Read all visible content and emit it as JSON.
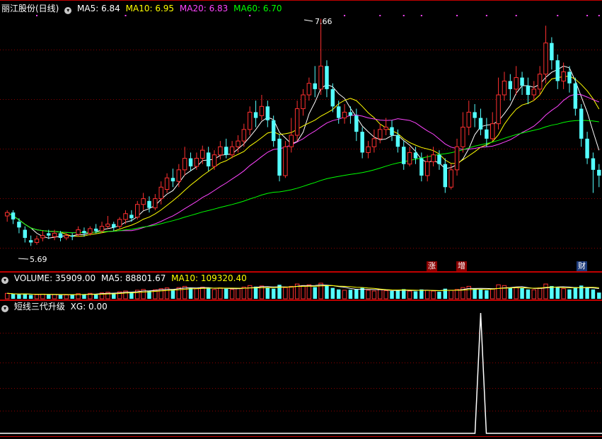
{
  "title": "丽江股份(日线)",
  "ma_legend": [
    {
      "label": "MA5: 6.84",
      "color": "#ffffff"
    },
    {
      "label": "MA10: 6.95",
      "color": "#ffff00"
    },
    {
      "label": "MA20: 6.83",
      "color": "#ff44ff"
    },
    {
      "label": "MA60: 6.70",
      "color": "#00ff00"
    }
  ],
  "high_label": "7.66",
  "low_label": "5.69",
  "volume_header": {
    "name": "VOLUME: 35909.00",
    "ma5": "MA5: 88801.67",
    "ma10": "MA10: 109320.40"
  },
  "indicator_header": {
    "name": "短线三代升级",
    "xg": "XG: 0.00"
  },
  "event_tags": [
    "涨",
    "增",
    "财"
  ],
  "colors": {
    "up": "#ff3030",
    "down": "#54ffff",
    "grid": "#8b0000",
    "ma5": "#ffffff",
    "ma10": "#ffff00",
    "ma20": "#ff44ff",
    "ma60": "#00ff00"
  },
  "chart_data": {
    "type": "candlestick",
    "ylim": [
      5.6,
      7.7
    ],
    "candles": [
      [
        5.95,
        5.98,
        5.9,
        6.0
      ],
      [
        5.98,
        5.92,
        5.88,
        6.0
      ],
      [
        5.9,
        5.85,
        5.8,
        5.93
      ],
      [
        5.83,
        5.76,
        5.72,
        5.86
      ],
      [
        5.74,
        5.72,
        5.69,
        5.78
      ],
      [
        5.72,
        5.75,
        5.7,
        5.78
      ],
      [
        5.76,
        5.78,
        5.73,
        5.82
      ],
      [
        5.8,
        5.78,
        5.75,
        5.83
      ],
      [
        5.77,
        5.8,
        5.74,
        5.83
      ],
      [
        5.8,
        5.76,
        5.73,
        5.82
      ],
      [
        5.76,
        5.78,
        5.74,
        5.8
      ],
      [
        5.78,
        5.77,
        5.74,
        5.8
      ],
      [
        5.79,
        5.83,
        5.77,
        5.86
      ],
      [
        5.82,
        5.8,
        5.77,
        5.85
      ],
      [
        5.8,
        5.84,
        5.78,
        5.86
      ],
      [
        5.84,
        5.82,
        5.8,
        5.88
      ],
      [
        5.82,
        5.86,
        5.8,
        5.9
      ],
      [
        5.86,
        5.88,
        5.84,
        5.95
      ],
      [
        5.88,
        5.85,
        5.82,
        5.9
      ],
      [
        5.86,
        5.92,
        5.84,
        5.94
      ],
      [
        5.92,
        5.97,
        5.88,
        6.0
      ],
      [
        5.96,
        5.93,
        5.9,
        6.0
      ],
      [
        5.94,
        6.05,
        5.92,
        6.08
      ],
      [
        6.05,
        6.1,
        6.0,
        6.15
      ],
      [
        6.08,
        6.02,
        5.98,
        6.12
      ],
      [
        6.02,
        6.1,
        6.0,
        6.14
      ],
      [
        6.1,
        6.2,
        6.05,
        6.25
      ],
      [
        6.18,
        6.28,
        6.15,
        6.32
      ],
      [
        6.28,
        6.25,
        6.2,
        6.36
      ],
      [
        6.25,
        6.35,
        6.2,
        6.4
      ],
      [
        6.35,
        6.45,
        6.3,
        6.55
      ],
      [
        6.45,
        6.38,
        6.34,
        6.5
      ],
      [
        6.38,
        6.45,
        6.35,
        6.5
      ],
      [
        6.45,
        6.52,
        6.4,
        6.56
      ],
      [
        6.5,
        6.38,
        6.34,
        6.55
      ],
      [
        6.38,
        6.48,
        6.35,
        6.52
      ],
      [
        6.48,
        6.55,
        6.44,
        6.6
      ],
      [
        6.55,
        6.48,
        6.45,
        6.62
      ],
      [
        6.48,
        6.55,
        6.45,
        6.6
      ],
      [
        6.55,
        6.6,
        6.5,
        6.65
      ],
      [
        6.6,
        6.7,
        6.55,
        6.75
      ],
      [
        6.7,
        6.85,
        6.65,
        6.9
      ],
      [
        6.85,
        6.8,
        6.72,
        6.95
      ],
      [
        6.82,
        6.9,
        6.78,
        7.0
      ],
      [
        6.9,
        6.78,
        6.72,
        6.95
      ],
      [
        6.78,
        6.6,
        6.55,
        6.82
      ],
      [
        6.62,
        6.3,
        6.25,
        6.66
      ],
      [
        6.3,
        6.55,
        6.28,
        6.6
      ],
      [
        6.55,
        6.65,
        6.5,
        6.8
      ],
      [
        6.65,
        6.88,
        6.6,
        6.95
      ],
      [
        6.88,
        7.0,
        6.82,
        7.05
      ],
      [
        7.0,
        7.1,
        6.95,
        7.15
      ],
      [
        7.1,
        7.05,
        6.98,
        7.25
      ],
      [
        7.05,
        7.25,
        7.0,
        7.66
      ],
      [
        7.25,
        7.05,
        6.98,
        7.3
      ],
      [
        7.05,
        6.9,
        6.85,
        7.1
      ],
      [
        6.9,
        6.8,
        6.75,
        6.95
      ],
      [
        6.8,
        6.85,
        6.75,
        6.92
      ],
      [
        6.85,
        6.82,
        6.75,
        6.9
      ],
      [
        6.82,
        6.68,
        6.6,
        6.88
      ],
      [
        6.68,
        6.5,
        6.45,
        6.72
      ],
      [
        6.5,
        6.55,
        6.45,
        6.6
      ],
      [
        6.55,
        6.62,
        6.5,
        6.7
      ],
      [
        6.62,
        6.7,
        6.58,
        6.75
      ],
      [
        6.7,
        6.72,
        6.65,
        6.8
      ],
      [
        6.72,
        6.65,
        6.6,
        6.78
      ],
      [
        6.65,
        6.55,
        6.5,
        6.7
      ],
      [
        6.55,
        6.4,
        6.35,
        6.6
      ],
      [
        6.4,
        6.5,
        6.38,
        6.55
      ],
      [
        6.5,
        6.45,
        6.4,
        6.55
      ],
      [
        6.45,
        6.3,
        6.25,
        6.5
      ],
      [
        6.3,
        6.42,
        6.25,
        6.48
      ],
      [
        6.42,
        6.48,
        6.38,
        6.55
      ],
      [
        6.48,
        6.4,
        6.35,
        6.52
      ],
      [
        6.4,
        6.2,
        6.15,
        6.45
      ],
      [
        6.2,
        6.35,
        6.18,
        6.4
      ],
      [
        6.35,
        6.55,
        6.3,
        6.62
      ],
      [
        6.55,
        6.72,
        6.5,
        6.85
      ],
      [
        6.72,
        6.85,
        6.65,
        6.95
      ],
      [
        6.85,
        6.8,
        6.72,
        6.92
      ],
      [
        6.8,
        6.7,
        6.65,
        6.88
      ],
      [
        6.7,
        6.62,
        6.55,
        6.8
      ],
      [
        6.62,
        6.75,
        6.6,
        6.85
      ],
      [
        6.75,
        7.0,
        6.7,
        7.15
      ],
      [
        7.0,
        7.12,
        6.95,
        7.2
      ],
      [
        7.12,
        7.05,
        6.95,
        7.18
      ],
      [
        7.05,
        7.15,
        7.0,
        7.25
      ],
      [
        7.15,
        7.08,
        7.0,
        7.2
      ],
      [
        7.08,
        7.0,
        6.92,
        7.15
      ],
      [
        7.0,
        7.05,
        6.95,
        7.12
      ],
      [
        7.05,
        7.18,
        7.0,
        7.25
      ],
      [
        7.18,
        7.45,
        7.1,
        7.6
      ],
      [
        7.45,
        7.3,
        7.22,
        7.5
      ],
      [
        7.3,
        7.12,
        7.05,
        7.35
      ],
      [
        7.12,
        7.2,
        7.05,
        7.28
      ],
      [
        7.2,
        7.1,
        7.02,
        7.25
      ],
      [
        7.1,
        6.88,
        6.82,
        7.15
      ],
      [
        6.88,
        6.62,
        6.55,
        6.92
      ],
      [
        6.62,
        6.45,
        6.4,
        6.68
      ],
      [
        6.45,
        6.35,
        6.15,
        6.5
      ],
      [
        6.35,
        6.3,
        6.2,
        6.4
      ]
    ],
    "volume": [
      0.35,
      0.3,
      0.28,
      0.32,
      0.25,
      0.27,
      0.3,
      0.26,
      0.28,
      0.24,
      0.25,
      0.27,
      0.33,
      0.3,
      0.35,
      0.3,
      0.38,
      0.42,
      0.36,
      0.45,
      0.5,
      0.42,
      0.55,
      0.6,
      0.5,
      0.58,
      0.65,
      0.7,
      0.6,
      0.72,
      0.8,
      0.7,
      0.65,
      0.75,
      0.68,
      0.6,
      0.7,
      0.65,
      0.6,
      0.68,
      0.75,
      0.85,
      0.78,
      0.82,
      0.7,
      0.65,
      0.9,
      0.72,
      0.8,
      0.95,
      0.85,
      0.9,
      0.75,
      1.0,
      0.88,
      0.7,
      0.6,
      0.55,
      0.58,
      0.62,
      0.7,
      0.55,
      0.5,
      0.58,
      0.52,
      0.5,
      0.55,
      0.62,
      0.5,
      0.48,
      0.6,
      0.55,
      0.5,
      0.45,
      0.65,
      0.55,
      0.6,
      0.72,
      0.8,
      0.65,
      0.6,
      0.55,
      0.62,
      0.9,
      0.85,
      0.7,
      0.75,
      0.68,
      0.6,
      0.58,
      0.7,
      0.95,
      0.82,
      0.75,
      0.65,
      0.6,
      0.75,
      0.85,
      0.7,
      0.6,
      0.4
    ],
    "indicator_peak_index": 80,
    "indicator_peak_value": 1
  }
}
